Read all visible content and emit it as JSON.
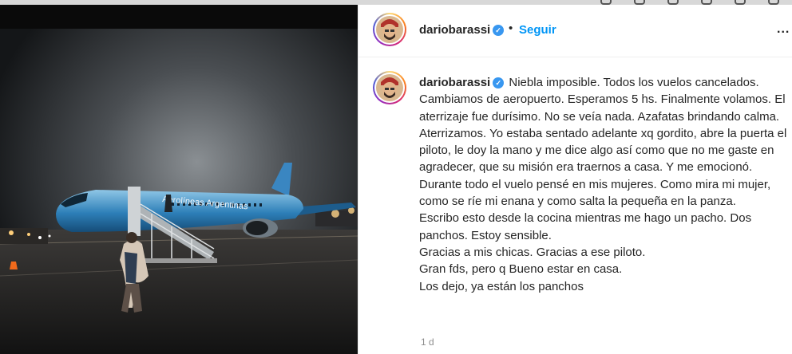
{
  "post": {
    "username": "dariobarassi",
    "follow_label": "Seguir",
    "dot": "•",
    "more_label": "...",
    "caption_first": "Niebla imposible. Todos los vuelos cancelados. Cambiamos de aeropuerto. Esperamos 5 hs. Finalmente volamos. El aterrizaje fue durísimo. No se veía nada. Azafatas brindando calma. Aterrizamos. Yo estaba sentado adelante xq gordito, abre la puerta el piloto, le doy la mano y me dice algo así como que no me gaste en agradecer, que su misión era traernos a casa. Y me emocionó.",
    "caption_lines": [
      "Durante todo el vuelo pensé en mis mujeres. Como mira mi mujer, como se ríe mi enana y como salta la pequeña en la panza.",
      "Escribo esto desde la cocina mientras me hago un pacho. Dos panchos. Estoy sensible.",
      "Gracias a mis chicas. Gracias a ese piloto.",
      "Gran fds, pero q Bueno estar en casa.",
      "Los dejo, ya están los panchos"
    ],
    "timestamp": "1 d",
    "photo_livery_text": "Aerolíneas Argentinas"
  },
  "colors": {
    "follow": "#0095f6",
    "verified": "#3897f0",
    "timestamp": "#8e8e8e"
  },
  "icons": [
    "verified-badge-icon",
    "more-options-icon",
    "avatar"
  ]
}
